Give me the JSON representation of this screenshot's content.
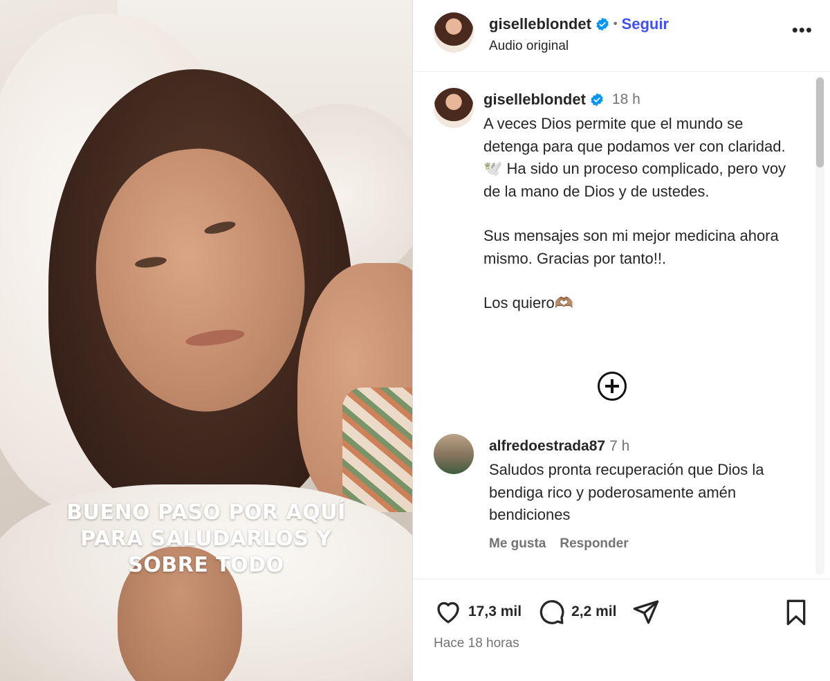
{
  "media": {
    "caption_lines": [
      "BUENO PASO POR AQUÍ",
      "PARA SALUDARLOS Y",
      "SOBRE TODO"
    ]
  },
  "header": {
    "username": "giselleblondet",
    "separator": "•",
    "follow_label": "Seguir",
    "subtitle": "Audio original",
    "more_label": "•••"
  },
  "post": {
    "username": "giselleblondet",
    "time": "18 h",
    "paragraphs": [
      "A veces Dios permite que el mundo se detenga para que podamos ver con claridad. 🕊️ Ha sido un proceso complicado, pero voy de la mano de Dios y de ustedes.",
      "Sus mensajes son mi mejor medicina ahora mismo. Gracias por tanto!!.",
      "Los quiero🫶🏽"
    ]
  },
  "comment": {
    "username": "alfredoestrada87",
    "time": "7 h",
    "text": "Saludos pronta recuperación que Dios la bendiga rico y poderosamente amén bendiciones",
    "like_label": "Me gusta",
    "reply_label": "Responder"
  },
  "footer": {
    "likes": "17,3 mil",
    "comments": "2,2 mil",
    "posted_ago": "Hace 18 horas"
  },
  "colors": {
    "accent": "#4150f7",
    "verified": "#0095f6",
    "muted": "#737373"
  },
  "icons": [
    "verified-badge-icon",
    "more-icon",
    "add-comment-icon",
    "heart-icon",
    "comment-icon",
    "share-icon",
    "bookmark-icon"
  ]
}
